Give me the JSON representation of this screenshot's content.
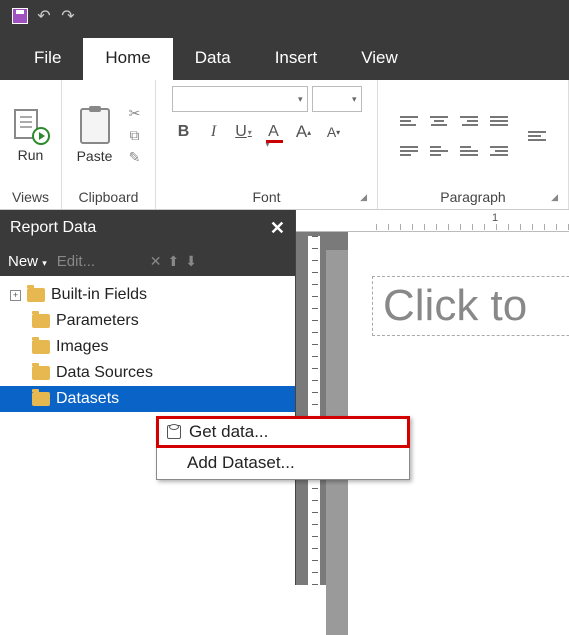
{
  "titlebar": {
    "save_tooltip": "Save"
  },
  "menu": {
    "file": "File",
    "home": "Home",
    "data": "Data",
    "insert": "Insert",
    "view": "View"
  },
  "ribbon": {
    "views": {
      "run": "Run",
      "label": "Views"
    },
    "clipboard": {
      "paste": "Paste",
      "label": "Clipboard"
    },
    "font": {
      "label": "Font",
      "bold": "B",
      "italic": "I",
      "underline": "U",
      "font_color": "A",
      "size_up": "A",
      "size_down": "A"
    },
    "paragraph": {
      "label": "Paragraph"
    }
  },
  "ruler": {
    "mark1": "1"
  },
  "report_data": {
    "title": "Report Data",
    "new": "New",
    "edit": "Edit...",
    "tree": {
      "builtin": "Built-in Fields",
      "parameters": "Parameters",
      "images": "Images",
      "data_sources": "Data Sources",
      "datasets": "Datasets"
    }
  },
  "canvas": {
    "title_placeholder": "Click to "
  },
  "context_menu": {
    "get_data": "Get data...",
    "add_dataset": "Add Dataset..."
  }
}
